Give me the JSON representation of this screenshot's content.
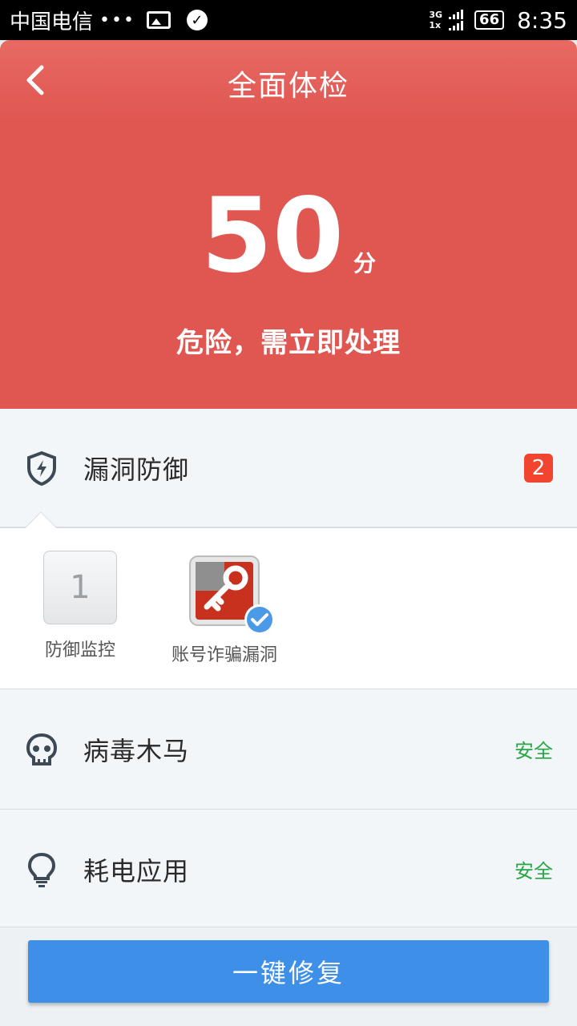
{
  "status_bar": {
    "carrier": "中国电信",
    "dots": "•••",
    "network_top": "3G",
    "network_bottom": "1x",
    "battery": "66",
    "time": "8:35"
  },
  "header": {
    "title": "全面体检",
    "score": "50",
    "score_unit": "分",
    "status": "危险，需立即处理",
    "bg_color": "#e05752"
  },
  "sections": {
    "vuln": {
      "label": "漏洞防御",
      "badge": "2",
      "icon": "shield-bolt-icon"
    },
    "virus": {
      "label": "病毒木马",
      "status": "安全",
      "icon": "skull-icon"
    },
    "power": {
      "label": "耗电应用",
      "status": "安全",
      "icon": "lightbulb-icon"
    }
  },
  "vuln_items": [
    {
      "number": "1",
      "label": "防御监控"
    },
    {
      "label": "账号诈骗漏洞",
      "icon": "key-lock-icon"
    }
  ],
  "actions": {
    "fix_label": "一键修复"
  },
  "colors": {
    "safe": "#28a745",
    "badge": "#f2452f",
    "button": "#3d8fe8"
  }
}
